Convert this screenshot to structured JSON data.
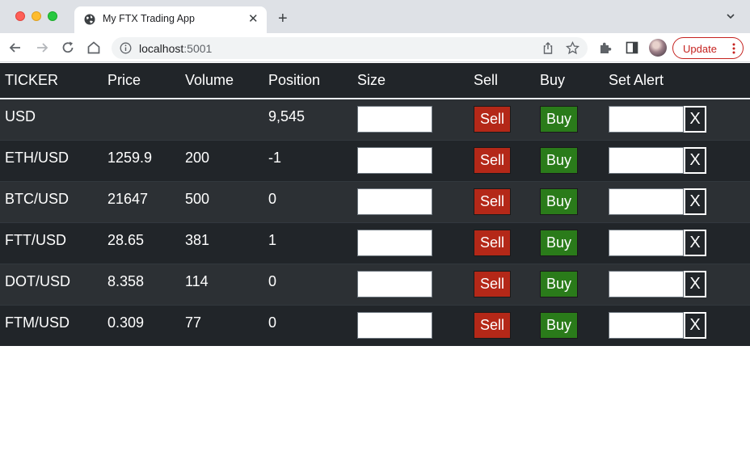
{
  "browser": {
    "tab_title": "My FTX Trading App",
    "url_host": "localhost",
    "url_port": ":5001",
    "update_label": "Update"
  },
  "table": {
    "headers": [
      "TICKER",
      "Price",
      "Volume",
      "Position",
      "Size",
      "Sell",
      "Buy",
      "Set Alert"
    ],
    "rows": [
      {
        "ticker": "USD",
        "price": "",
        "volume": "",
        "position": "9,545"
      },
      {
        "ticker": "ETH/USD",
        "price": "1259.9",
        "volume": "200",
        "position": "-1"
      },
      {
        "ticker": "BTC/USD",
        "price": "21647",
        "volume": "500",
        "position": "0"
      },
      {
        "ticker": "FTT/USD",
        "price": "28.65",
        "volume": "381",
        "position": "1"
      },
      {
        "ticker": "DOT/USD",
        "price": "8.358",
        "volume": "114",
        "position": "0"
      },
      {
        "ticker": "FTM/USD",
        "price": "0.309",
        "volume": "77",
        "position": "0"
      }
    ],
    "sell_label": "Sell",
    "buy_label": "Buy",
    "clear_label": "X"
  },
  "colors": {
    "table_bg": "#212529",
    "row_stripe": "#2c3034",
    "sell": "#b42818",
    "buy": "#2a7b1a",
    "update_accent": "#c5221f"
  }
}
